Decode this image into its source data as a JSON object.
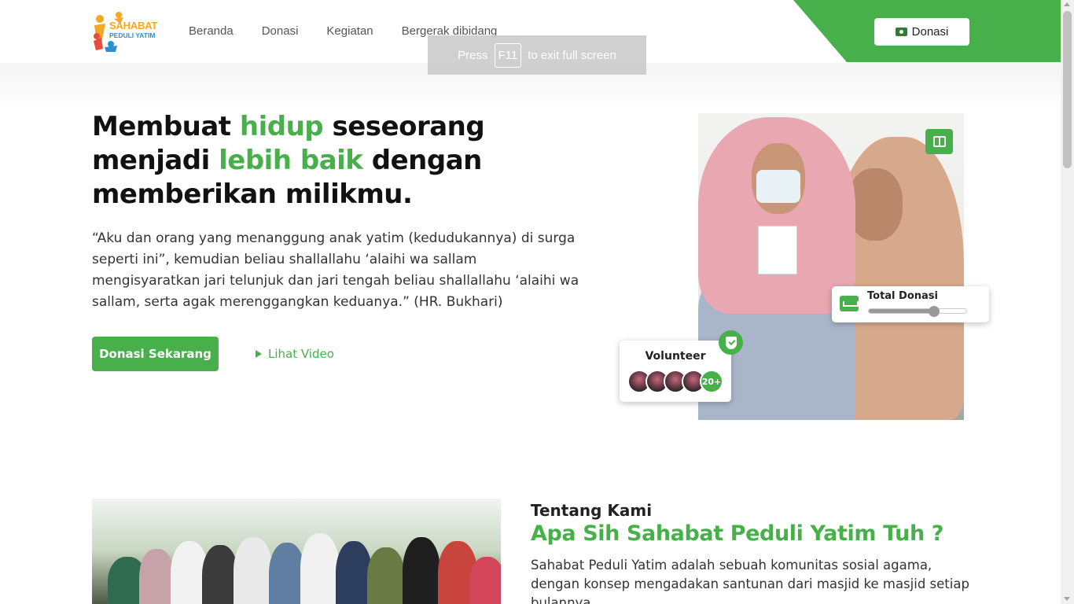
{
  "header": {
    "logo": {
      "line1": "SAHABAT",
      "line2": "PEDULI YATIM"
    },
    "nav": [
      "Beranda",
      "Donasi",
      "Kegiatan",
      "Bergerak dibidang"
    ],
    "donate_button": "Donasi",
    "donate_icon": "money-icon",
    "accent_color": "#47b04b"
  },
  "fullscreen_toast": {
    "prefix": "Press",
    "key": "F11",
    "suffix": "to exit full screen"
  },
  "hero": {
    "title_parts": [
      "Membuat ",
      "hidup",
      " seseorang menjadi ",
      "lebih baik",
      " dengan memberikan milikmu."
    ],
    "quote": "“Aku dan orang yang menanggung anak yatim (kedudukannya) di surga seperti ini”, kemudian beliau shallallahu ‘alaihi wa sallam mengisyaratkan jari telunjuk dan jari tengah beliau shallallahu ‘alaihi wa sallam, serta agak merenggangkan keduanya.” (HR. Bukhari)",
    "primary_button": "Donasi Sekarang",
    "video_link": "Lihat Video"
  },
  "hero_cards": {
    "total_donasi": {
      "label": "Total Donasi",
      "progress": 0.67
    },
    "volunteer": {
      "label": "Volunteer",
      "more": "20+",
      "avatar_count": 4
    }
  },
  "about": {
    "subtitle": "Tentang Kami",
    "title": "Apa Sih Sahabat Peduli Yatim Tuh ?",
    "text": "Sahabat Peduli Yatim adalah sebuah komunitas sosial agama, dengan konsep mengadakan santunan dari masjid ke masjid setiap bulannya."
  }
}
